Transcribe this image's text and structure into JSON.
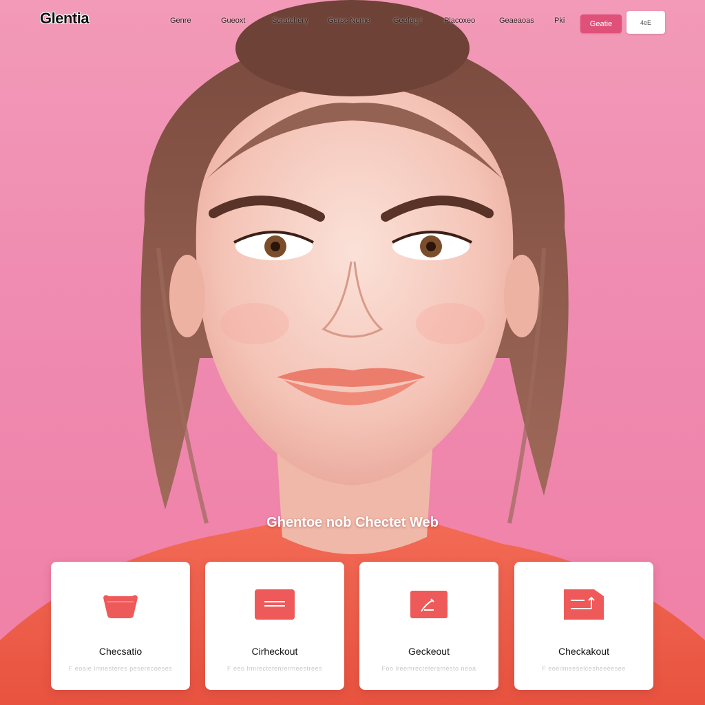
{
  "brand": {
    "logo": "Glentia"
  },
  "nav": {
    "items": [
      {
        "label": "Genre"
      },
      {
        "label": "Gueoxt"
      },
      {
        "label": "Scratchery"
      },
      {
        "label": "Gersc Nome"
      },
      {
        "label": "Geefeg !"
      },
      {
        "label": "Placoxeo"
      },
      {
        "label": "Geaeaoas"
      },
      {
        "label": "Pki"
      }
    ],
    "primary_button": "Geatie",
    "secondary_button": "4eE"
  },
  "hero": {
    "title": "Ghentoe nob Chectet Web"
  },
  "cards": [
    {
      "title": "Checsatio",
      "subtitle": "F eoaie lmnesteres peserecoeses",
      "icon": "basket-icon"
    },
    {
      "title": "Cirheckout",
      "subtitle": "F eeo lrmrectetenrermeestrees",
      "icon": "wallet-icon"
    },
    {
      "title": "Geckeout",
      "subtitle": "Foo lreemrecteteramesto neoa",
      "icon": "document-edit-icon"
    },
    {
      "title": "Checkakout",
      "subtitle": "F eoeilmeeselcesheeeesee",
      "icon": "folder-arrow-icon"
    }
  ],
  "colors": {
    "background": "#f08fb0",
    "accent": "#ee5a5a",
    "primary_button": "#e0517a",
    "card": "#ffffff"
  }
}
